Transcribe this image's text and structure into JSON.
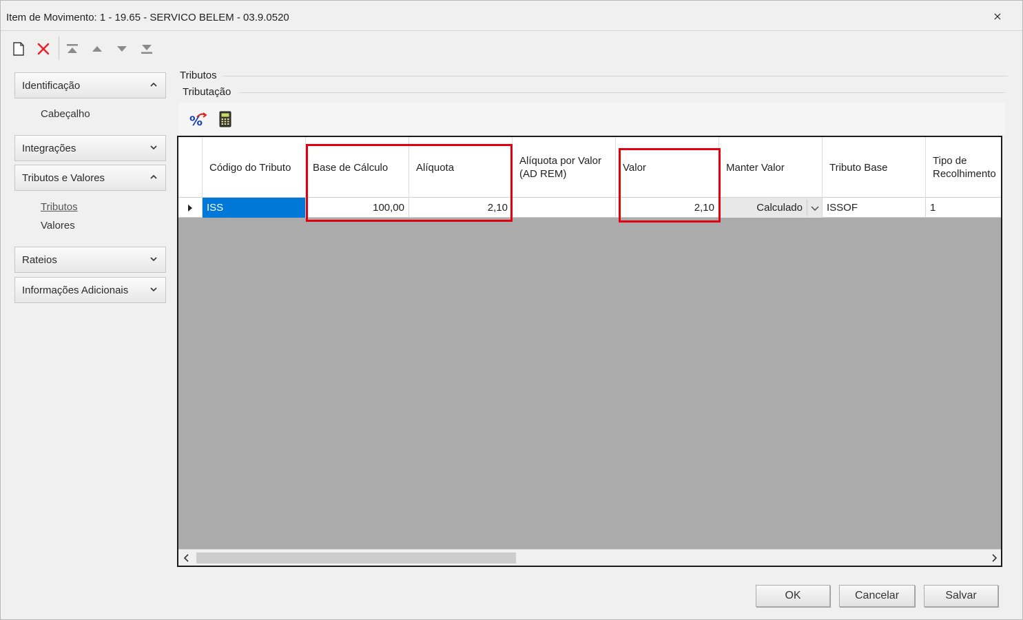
{
  "window": {
    "title": "Item de Movimento: 1 - 19.65 - SERVICO BELEM - 03.9.0520",
    "close_symbol": "⨯"
  },
  "toolbar": {
    "icons": [
      "new-document-icon",
      "delete-icon",
      "move-first-icon",
      "move-up-icon",
      "move-down-icon",
      "move-last-icon"
    ]
  },
  "nav": {
    "groups": [
      {
        "label": "Identificação",
        "expanded": true,
        "items": [
          "Cabeçalho"
        ]
      },
      {
        "label": "Integrações",
        "expanded": false,
        "items": []
      },
      {
        "label": "Tributos e Valores",
        "expanded": true,
        "items": [
          "Tributos",
          "Valores"
        ],
        "active_item": "Tributos"
      },
      {
        "label": "Rateios",
        "expanded": false,
        "items": []
      },
      {
        "label": "Informações Adicionais",
        "expanded": false,
        "items": []
      }
    ]
  },
  "content": {
    "section_title": "Tributos",
    "subsection_title": "Tributação",
    "icons": [
      "percent-recalc-icon",
      "calculator-icon"
    ]
  },
  "grid": {
    "columns": [
      "Código do Tributo",
      "Base de Cálculo",
      "Alíquota",
      "Alíquota por Valor (AD REM)",
      "Valor",
      "Manter Valor",
      "Tributo Base",
      "Tipo de Recolhimento"
    ],
    "rows": [
      {
        "codigo": "ISS",
        "base_calculo": "100,00",
        "aliquota": "2,10",
        "aliquota_valor": "",
        "valor": "2,10",
        "manter_valor": "Calculado",
        "tributo_base": "ISSOF",
        "tipo_recolhimento": "1"
      }
    ]
  },
  "colors": {
    "highlight": "#e0000f",
    "selection": "#0078d7"
  },
  "buttons": {
    "ok": "OK",
    "cancel": "Cancelar",
    "save": "Salvar"
  }
}
